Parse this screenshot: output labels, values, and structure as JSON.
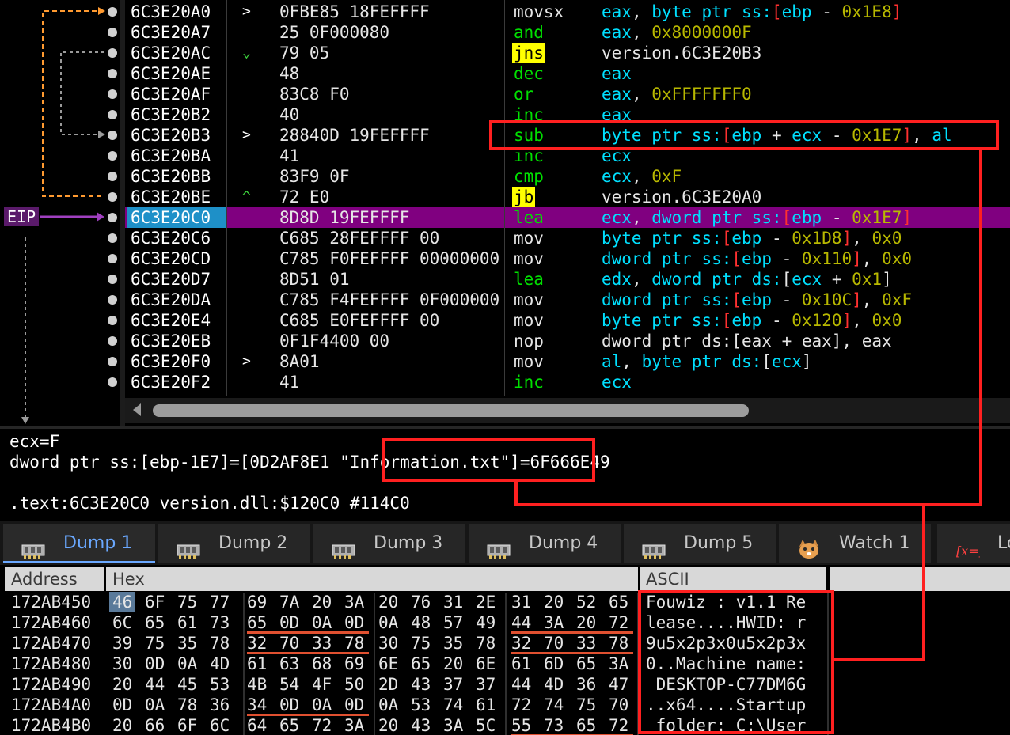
{
  "disasm": {
    "eip_label": "EIP",
    "rows": [
      {
        "addr": "6C3E20A0",
        "jmp": ">",
        "jmp_color": "white",
        "bytes": "0FBE85 18FEFFFF",
        "mn": "movsx",
        "mn_style": "plain",
        "ops": [
          [
            "eax",
            "reg"
          ],
          [
            ", ",
            "op"
          ],
          [
            "byte ptr ",
            "ptr"
          ],
          [
            "ss:",
            "seg"
          ],
          [
            "[",
            "br"
          ],
          [
            "ebp",
            "reg"
          ],
          [
            " - ",
            "op"
          ],
          [
            "0x1E8",
            "num"
          ],
          [
            "]",
            "br"
          ]
        ]
      },
      {
        "addr": "6C3E20A7",
        "jmp": "",
        "bytes": "25 0F000080",
        "mn": "and",
        "mn_style": "arith",
        "ops": [
          [
            "eax",
            "reg"
          ],
          [
            ", ",
            "op"
          ],
          [
            "0x8000000F",
            "num"
          ]
        ]
      },
      {
        "addr": "6C3E20AC",
        "jmp": "⌄",
        "jmp_color": "green",
        "bytes": "79 05",
        "mn": "jns",
        "mn_style": "cond",
        "ops": [
          [
            "version.6C3E20B3",
            "sym"
          ]
        ]
      },
      {
        "addr": "6C3E20AE",
        "jmp": "",
        "bytes": "48",
        "mn": "dec",
        "mn_style": "arith",
        "ops": [
          [
            "eax",
            "reg"
          ]
        ]
      },
      {
        "addr": "6C3E20AF",
        "jmp": "",
        "bytes": "83C8 F0",
        "mn": "or",
        "mn_style": "arith",
        "ops": [
          [
            "eax",
            "reg"
          ],
          [
            ", ",
            "op"
          ],
          [
            "0xFFFFFFF0",
            "num"
          ]
        ]
      },
      {
        "addr": "6C3E20B2",
        "jmp": "",
        "bytes": "40",
        "mn": "inc",
        "mn_style": "arith",
        "ops": [
          [
            "eax",
            "reg"
          ]
        ]
      },
      {
        "addr": "6C3E20B3",
        "jmp": ">",
        "jmp_color": "white",
        "bytes": "28840D 19FEFFFF",
        "mn": "sub",
        "mn_style": "arith",
        "ops": [
          [
            "byte ptr ",
            "ptr"
          ],
          [
            "ss:",
            "seg"
          ],
          [
            "[",
            "br"
          ],
          [
            "ebp",
            "reg"
          ],
          [
            " + ",
            "op"
          ],
          [
            "ecx",
            "reg"
          ],
          [
            " - ",
            "op"
          ],
          [
            "0x1E7",
            "num"
          ],
          [
            "]",
            "br"
          ],
          [
            ", ",
            "op"
          ],
          [
            "al",
            "reg"
          ]
        ]
      },
      {
        "addr": "6C3E20BA",
        "jmp": "",
        "bytes": "41",
        "mn": "inc",
        "mn_style": "arith",
        "ops": [
          [
            "ecx",
            "reg"
          ]
        ]
      },
      {
        "addr": "6C3E20BB",
        "jmp": "",
        "bytes": "83F9 0F",
        "mn": "cmp",
        "mn_style": "arith",
        "ops": [
          [
            "ecx",
            "reg"
          ],
          [
            ", ",
            "op"
          ],
          [
            "0xF",
            "num"
          ]
        ]
      },
      {
        "addr": "6C3E20BE",
        "jmp": "^",
        "jmp_color": "green",
        "bytes": "72 E0",
        "mn": "jb",
        "mn_style": "cond",
        "ops": [
          [
            "version.6C3E20A0",
            "sym"
          ]
        ]
      },
      {
        "addr": "6C3E20C0",
        "jmp": "",
        "bytes": "8D8D 19FEFFFF",
        "mn": "lea",
        "mn_style": "arith",
        "eip": true,
        "ops": [
          [
            "ecx",
            "reg"
          ],
          [
            ", ",
            "op"
          ],
          [
            "dword ptr ",
            "ptr"
          ],
          [
            "ss:",
            "seg"
          ],
          [
            "[",
            "br"
          ],
          [
            "ebp",
            "reg"
          ],
          [
            " - ",
            "op"
          ],
          [
            "0x1E7",
            "num"
          ],
          [
            "]",
            "br"
          ]
        ]
      },
      {
        "addr": "6C3E20C6",
        "jmp": "",
        "bytes": "C685 28FEFFFF 00",
        "mn": "mov",
        "mn_style": "plain",
        "ops": [
          [
            "byte ptr ",
            "ptr"
          ],
          [
            "ss:",
            "seg"
          ],
          [
            "[",
            "br"
          ],
          [
            "ebp",
            "reg"
          ],
          [
            " - ",
            "op"
          ],
          [
            "0x1D8",
            "num"
          ],
          [
            "]",
            "br"
          ],
          [
            ", ",
            "op"
          ],
          [
            "0x0",
            "num"
          ]
        ]
      },
      {
        "addr": "6C3E20CD",
        "jmp": "",
        "bytes": "C785 F0FEFFFF 00000000",
        "mn": "mov",
        "mn_style": "plain",
        "ops": [
          [
            "dword ptr ",
            "ptr"
          ],
          [
            "ss:",
            "seg"
          ],
          [
            "[",
            "br"
          ],
          [
            "ebp",
            "reg"
          ],
          [
            " - ",
            "op"
          ],
          [
            "0x110",
            "num"
          ],
          [
            "]",
            "br"
          ],
          [
            ", ",
            "op"
          ],
          [
            "0x0",
            "num"
          ]
        ]
      },
      {
        "addr": "6C3E20D7",
        "jmp": "",
        "bytes": "8D51 01",
        "mn": "lea",
        "mn_style": "arith",
        "ops": [
          [
            "edx",
            "reg"
          ],
          [
            ", ",
            "op"
          ],
          [
            "dword ptr ",
            "ptr"
          ],
          [
            "ds:",
            "seg"
          ],
          [
            "[",
            "op"
          ],
          [
            "ecx",
            "reg"
          ],
          [
            " + ",
            "op"
          ],
          [
            "0x1",
            "num"
          ],
          [
            "]",
            "op"
          ]
        ]
      },
      {
        "addr": "6C3E20DA",
        "jmp": "",
        "bytes": "C785 F4FEFFFF 0F000000",
        "mn": "mov",
        "mn_style": "plain",
        "ops": [
          [
            "dword ptr ",
            "ptr"
          ],
          [
            "ss:",
            "seg"
          ],
          [
            "[",
            "br"
          ],
          [
            "ebp",
            "reg"
          ],
          [
            " - ",
            "op"
          ],
          [
            "0x10C",
            "num"
          ],
          [
            "]",
            "br"
          ],
          [
            ", ",
            "op"
          ],
          [
            "0xF",
            "num"
          ]
        ]
      },
      {
        "addr": "6C3E20E4",
        "jmp": "",
        "bytes": "C685 E0FEFFFF 00",
        "mn": "mov",
        "mn_style": "plain",
        "ops": [
          [
            "byte ptr ",
            "ptr"
          ],
          [
            "ss:",
            "seg"
          ],
          [
            "[",
            "br"
          ],
          [
            "ebp",
            "reg"
          ],
          [
            " - ",
            "op"
          ],
          [
            "0x120",
            "num"
          ],
          [
            "]",
            "br"
          ],
          [
            ", ",
            "op"
          ],
          [
            "0x0",
            "num"
          ]
        ]
      },
      {
        "addr": "6C3E20EB",
        "jmp": "",
        "bytes": "0F1F4400 00",
        "mn": "nop",
        "mn_style": "plain",
        "ops": [
          [
            "dword ptr ds:[eax + eax], eax",
            "plain"
          ]
        ]
      },
      {
        "addr": "6C3E20F0",
        "jmp": ">",
        "jmp_color": "white",
        "bytes": "8A01",
        "mn": "mov",
        "mn_style": "plain",
        "ops": [
          [
            "al",
            "reg"
          ],
          [
            ", ",
            "op"
          ],
          [
            "byte ptr ",
            "ptr"
          ],
          [
            "ds:",
            "seg"
          ],
          [
            "[",
            "op"
          ],
          [
            "ecx",
            "reg"
          ],
          [
            "]",
            "op"
          ]
        ]
      },
      {
        "addr": "6C3E20F2",
        "jmp": "",
        "bytes": "41",
        "mn": "inc",
        "mn_style": "arith",
        "ops": [
          [
            "ecx",
            "reg"
          ]
        ]
      }
    ]
  },
  "info": {
    "line1": "ecx=F",
    "line2_prefix": "dword ptr ss:[ebp-1E7]=[0D2AF8E1 ",
    "line2_string": "\"Information.txt\"",
    "line2_suffix": "]=6F666E49",
    "line3": ".text:6C3E20C0 version.dll:$120C0 #114C0"
  },
  "tabs": [
    {
      "label": "Dump 1",
      "icon": "memory-chip-icon",
      "active": true
    },
    {
      "label": "Dump 2",
      "icon": "memory-chip-icon"
    },
    {
      "label": "Dump 3",
      "icon": "memory-chip-icon"
    },
    {
      "label": "Dump 4",
      "icon": "memory-chip-icon"
    },
    {
      "label": "Dump 5",
      "icon": "memory-chip-icon"
    },
    {
      "label": "Watch 1",
      "icon": "watch-cat-icon"
    },
    {
      "label": "Lo",
      "icon": "locals-x-icon"
    }
  ],
  "dump": {
    "headers": {
      "address": "Address",
      "hex": "Hex",
      "ascii": "ASCII"
    },
    "rows": [
      {
        "addr": "172AB450",
        "hex": [
          "46",
          "6F",
          "75",
          "77",
          "69",
          "7A",
          "20",
          "3A",
          "20",
          "76",
          "31",
          "2E",
          "31",
          "20",
          "52",
          "65"
        ],
        "ascii": "Fouwiz : v1.1 Re"
      },
      {
        "addr": "172AB460",
        "hex": [
          "6C",
          "65",
          "61",
          "73",
          "65",
          "0D",
          "0A",
          "0D",
          "0A",
          "48",
          "57",
          "49",
          "44",
          "3A",
          "20",
          "72"
        ],
        "ascii": "lease....HWID: r"
      },
      {
        "addr": "172AB470",
        "hex": [
          "39",
          "75",
          "35",
          "78",
          "32",
          "70",
          "33",
          "78",
          "30",
          "75",
          "35",
          "78",
          "32",
          "70",
          "33",
          "78"
        ],
        "ascii": "9u5x2p3x0u5x2p3x"
      },
      {
        "addr": "172AB480",
        "hex": [
          "30",
          "0D",
          "0A",
          "4D",
          "61",
          "63",
          "68",
          "69",
          "6E",
          "65",
          "20",
          "6E",
          "61",
          "6D",
          "65",
          "3A"
        ],
        "ascii": "0..Machine name:"
      },
      {
        "addr": "172AB490",
        "hex": [
          "20",
          "44",
          "45",
          "53",
          "4B",
          "54",
          "4F",
          "50",
          "2D",
          "43",
          "37",
          "37",
          "44",
          "4D",
          "36",
          "47"
        ],
        "ascii": " DESKTOP-C77DM6G"
      },
      {
        "addr": "172AB4A0",
        "hex": [
          "0D",
          "0A",
          "78",
          "36",
          "34",
          "0D",
          "0A",
          "0D",
          "0A",
          "53",
          "74",
          "61",
          "72",
          "74",
          "75",
          "70"
        ],
        "ascii": "..x64....Startup"
      },
      {
        "addr": "172AB4B0",
        "hex": [
          "20",
          "66",
          "6F",
          "6C",
          "64",
          "65",
          "72",
          "3A",
          "20",
          "43",
          "3A",
          "5C",
          "55",
          "73",
          "65",
          "72"
        ],
        "ascii": " folder: C:\\User"
      }
    ]
  },
  "colors": {
    "eip_row": "#800080",
    "highlight": "#ff2020",
    "cond_jump_bg": "#ffff00",
    "hex_underline": "#e05030"
  }
}
